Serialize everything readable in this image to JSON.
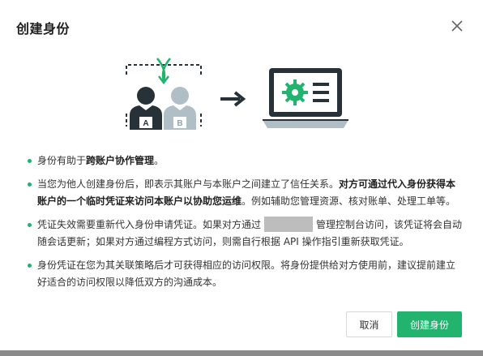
{
  "dialog": {
    "title": "创建身份",
    "close_icon": "close-icon"
  },
  "illustration": {
    "label_a": "A",
    "label_b": "B",
    "icons": [
      "two-users-swap-icon",
      "arrow-right-icon",
      "laptop-gear-icon"
    ],
    "colors": {
      "accent": "#22b46f",
      "dark": "#263238",
      "muted": "#b0bec5"
    }
  },
  "bullets": [
    {
      "parts": [
        {
          "text": "身份有助于",
          "bold": false
        },
        {
          "text": "跨账户协作管理",
          "bold": true
        },
        {
          "text": "。",
          "bold": false
        }
      ]
    },
    {
      "parts": [
        {
          "text": "当您为他人创建身份后，即表示其账户与本账户之间建立了信任关系。",
          "bold": false
        },
        {
          "text": "对方可通过代入身份获得本账户的一个临时凭证来访问本账户以协助您运维",
          "bold": true
        },
        {
          "text": "。例如辅助您管理资源、核对账单、处理工单等。",
          "bold": false
        }
      ]
    },
    {
      "parts": [
        {
          "text": "凭证失效需要重新代入身份申请凭证。如果对方通过",
          "bold": false
        },
        {
          "redacted": true
        },
        {
          "text": "管理控制台访问，该凭证将会自动随会话更新；如果对方通过编程方式访问，则需自行根据 API 操作指引重新获取凭证。",
          "bold": false
        }
      ]
    },
    {
      "parts": [
        {
          "text": "身份凭证在您为其关联策略后才可获得相应的访问权限。将身份提供给对方使用前，建议提前建立好适合的访问权限以降低双方的沟通成本。",
          "bold": false
        }
      ]
    }
  ],
  "buttons": {
    "cancel": "取消",
    "create": "创建身份"
  },
  "colors": {
    "primary": "#22b46f",
    "bullet": "#20b174"
  }
}
